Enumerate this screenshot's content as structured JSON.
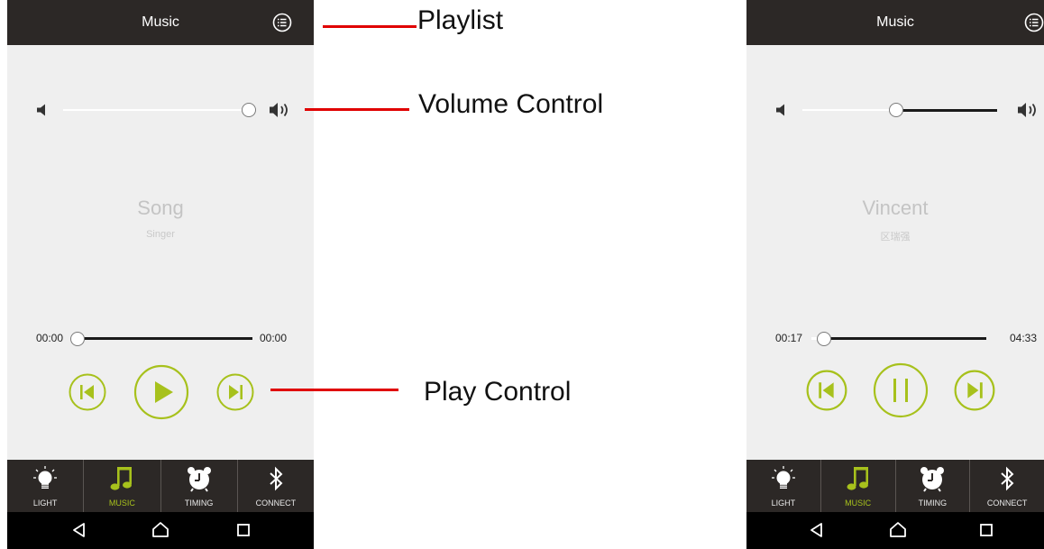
{
  "colors": {
    "accent": "#a7c11c",
    "bar": "#2c2826",
    "screen": "#efefef",
    "annotation": "#e00000"
  },
  "annotations": {
    "playlist": "Playlist",
    "volume": "Volume Control",
    "play": "Play Control"
  },
  "screens": [
    {
      "title": "Music",
      "playlist_icon": "playlist-icon",
      "volume_level": 1.0,
      "song": "Song",
      "singer": "Singer",
      "time_current": "00:00",
      "time_total": "00:00",
      "progress": 0.0,
      "play_state": "play",
      "tabs": [
        "LIGHT",
        "MUSIC",
        "TIMING",
        "CONNECT"
      ],
      "active_tab": "MUSIC"
    },
    {
      "title": "Music",
      "playlist_icon": "playlist-icon",
      "volume_level": 0.48,
      "song": "Vincent",
      "singer": "区瑞强",
      "time_current": "00:17",
      "time_total": "04:33",
      "progress": 0.07,
      "play_state": "pause",
      "tabs": [
        "LIGHT",
        "MUSIC",
        "TIMING",
        "CONNECT"
      ],
      "active_tab": "MUSIC"
    }
  ]
}
